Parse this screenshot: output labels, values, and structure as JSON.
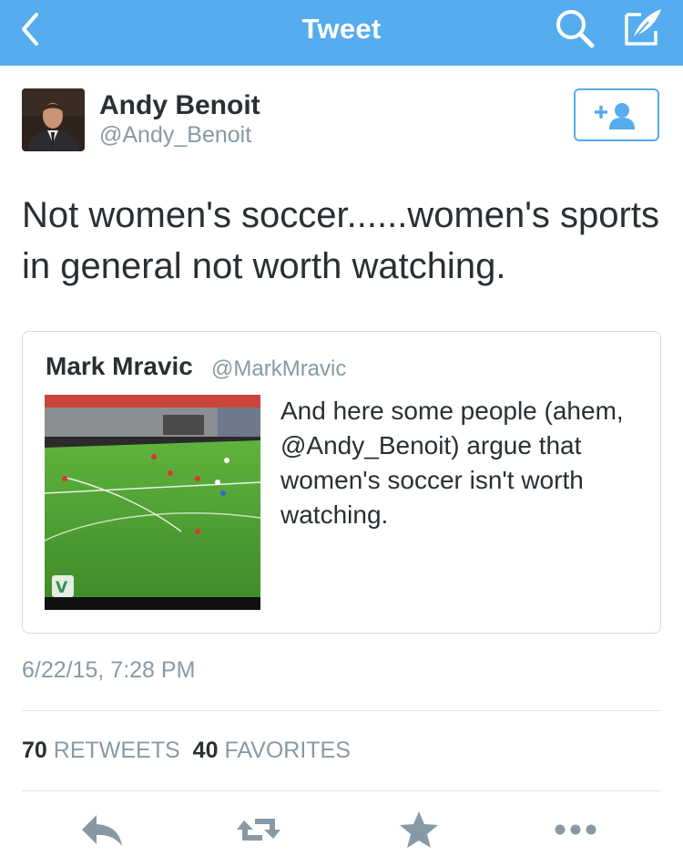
{
  "navbar": {
    "title": "Tweet",
    "icons": [
      "back-chevron-icon",
      "search-icon",
      "compose-icon"
    ]
  },
  "tweet": {
    "author_name": "Andy Benoit",
    "author_handle": "@Andy_Benoit",
    "text": "Not women's soccer......women's sports in general not worth watching.",
    "timestamp": "6/22/15, 7:28 PM",
    "retweet_count": "70",
    "retweet_label": "RETWEETS",
    "favorite_count": "40",
    "favorite_label": "FAVORITES"
  },
  "quoted_tweet": {
    "author_name": "Mark Mravic",
    "author_handle": "@MarkMravic",
    "text": "And here some people (ahem, @Andy_Benoit) argue that women's soccer isn't worth watching.",
    "media": "soccer match video thumbnail with vine logo"
  },
  "actions": [
    "reply-icon",
    "retweet-icon",
    "favorite-star-icon",
    "more-icon"
  ],
  "colors": {
    "accent": "#55acee",
    "text": "#292f33",
    "secondary": "#8899a6",
    "action_gray": "#8899a6",
    "border": "#e1e8ed"
  }
}
